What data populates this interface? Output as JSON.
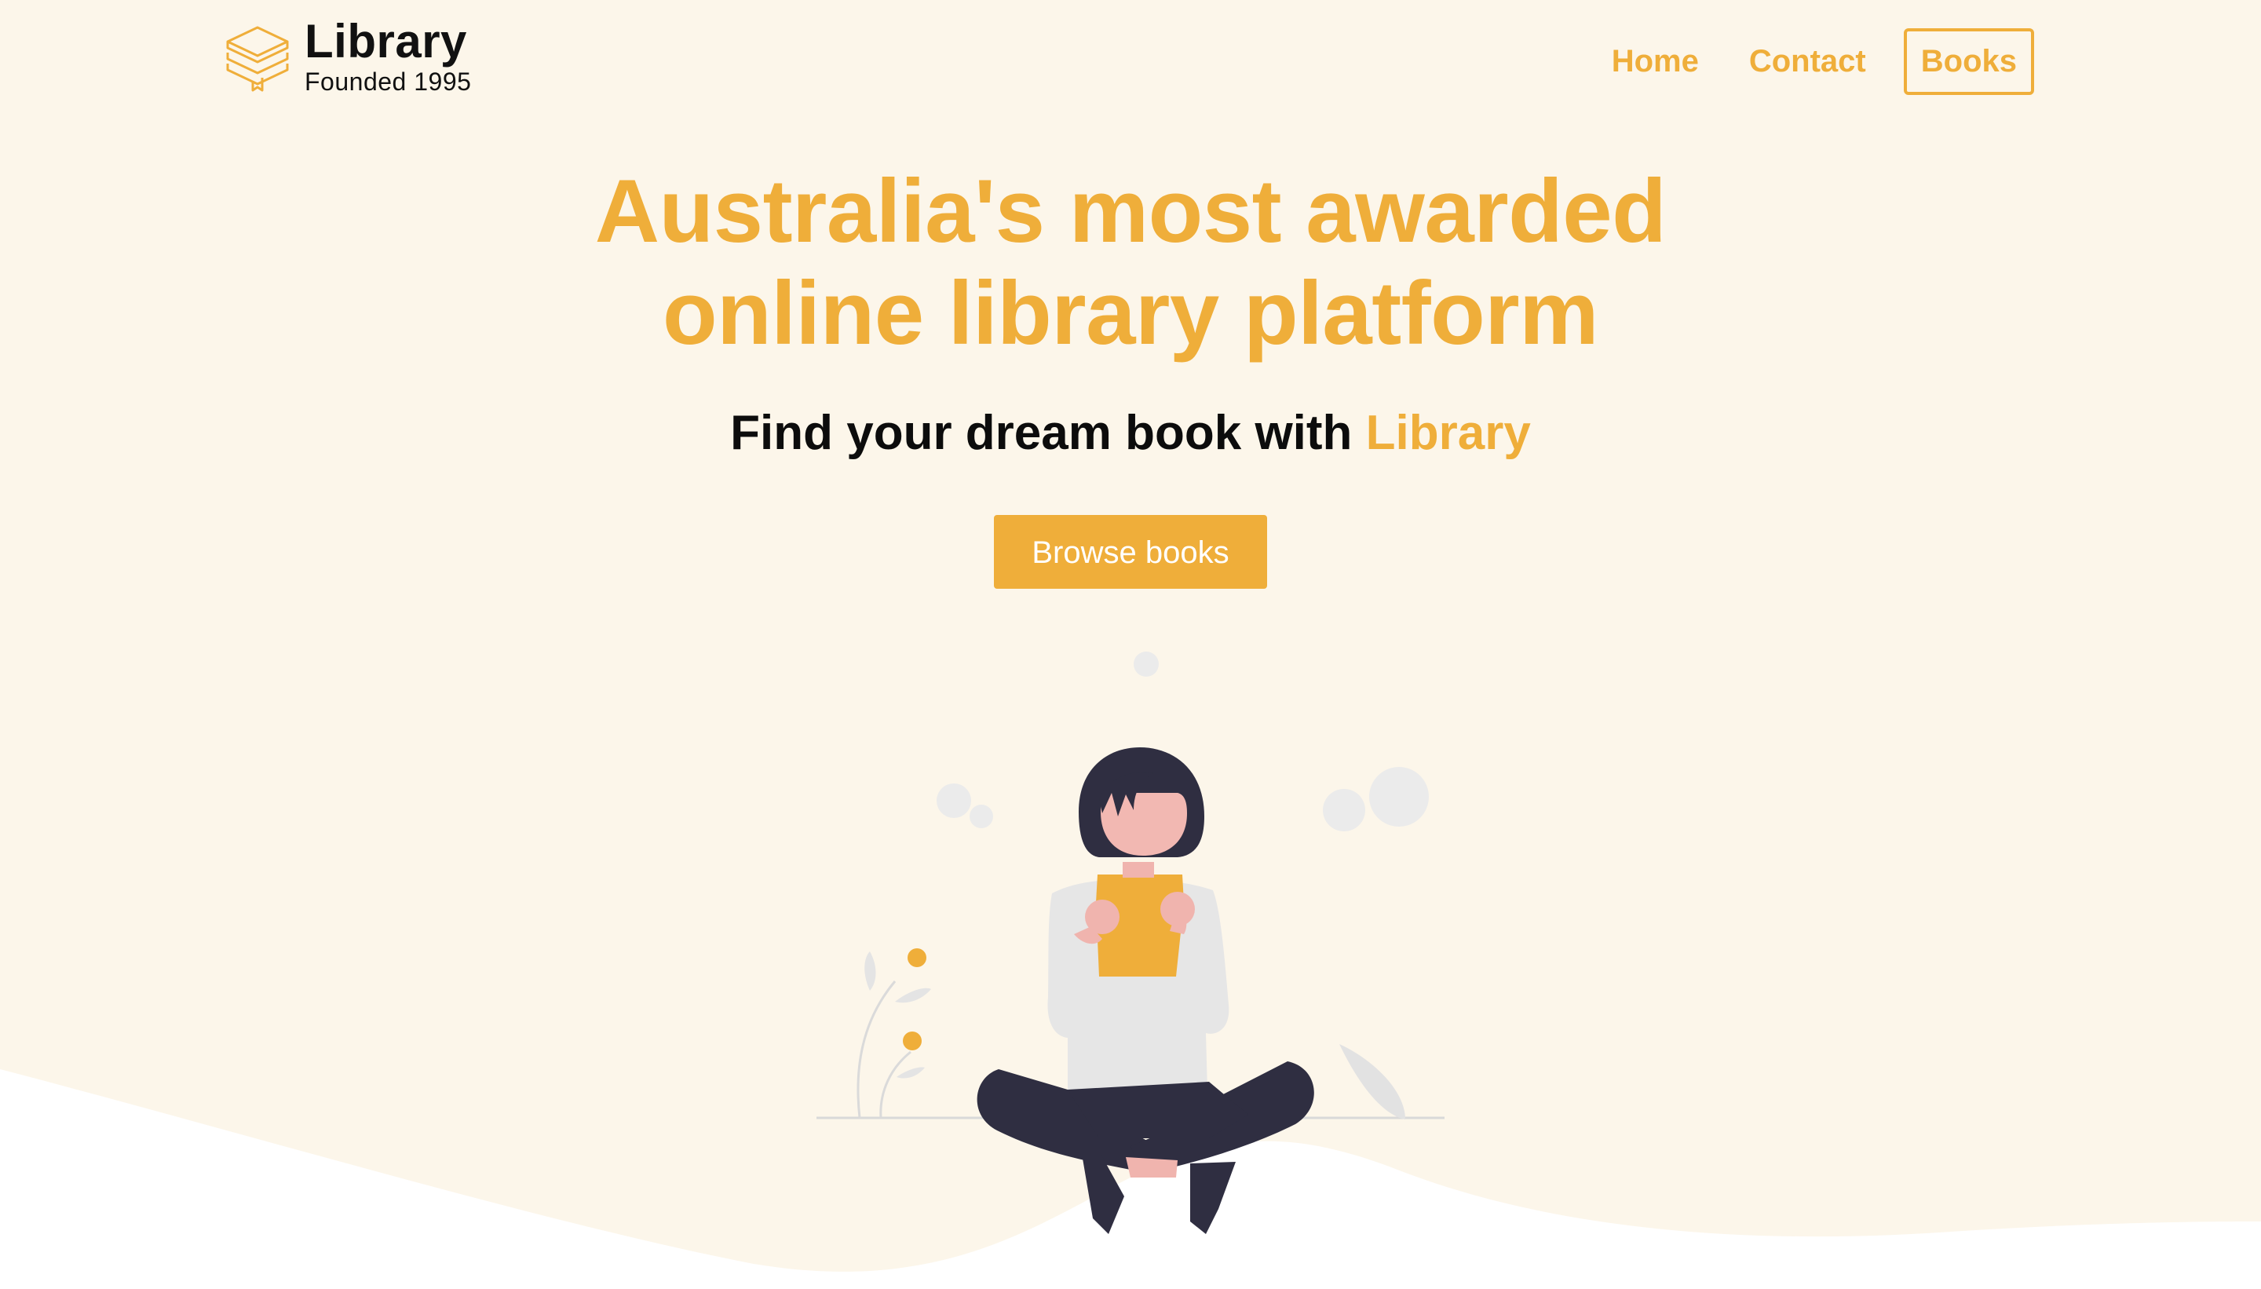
{
  "header": {
    "logo_icon": "stacked-books-icon",
    "logo_title": "Library",
    "logo_subtitle": "Founded 1995"
  },
  "nav": {
    "items": [
      {
        "label": "Home"
      },
      {
        "label": "Contact"
      },
      {
        "label": "Books"
      }
    ]
  },
  "hero": {
    "title_line1": "Australia's most awarded",
    "title_line2": "online library platform",
    "subtitle_prefix": "Find your dream book with ",
    "subtitle_accent": "Library",
    "cta_label": "Browse books"
  },
  "illustration": {
    "name": "woman-reading-book-illustration"
  },
  "colors": {
    "accent": "#efae3a",
    "background": "#fcf6ea",
    "text": "#0c0c0c",
    "wave": "#ffffff"
  }
}
